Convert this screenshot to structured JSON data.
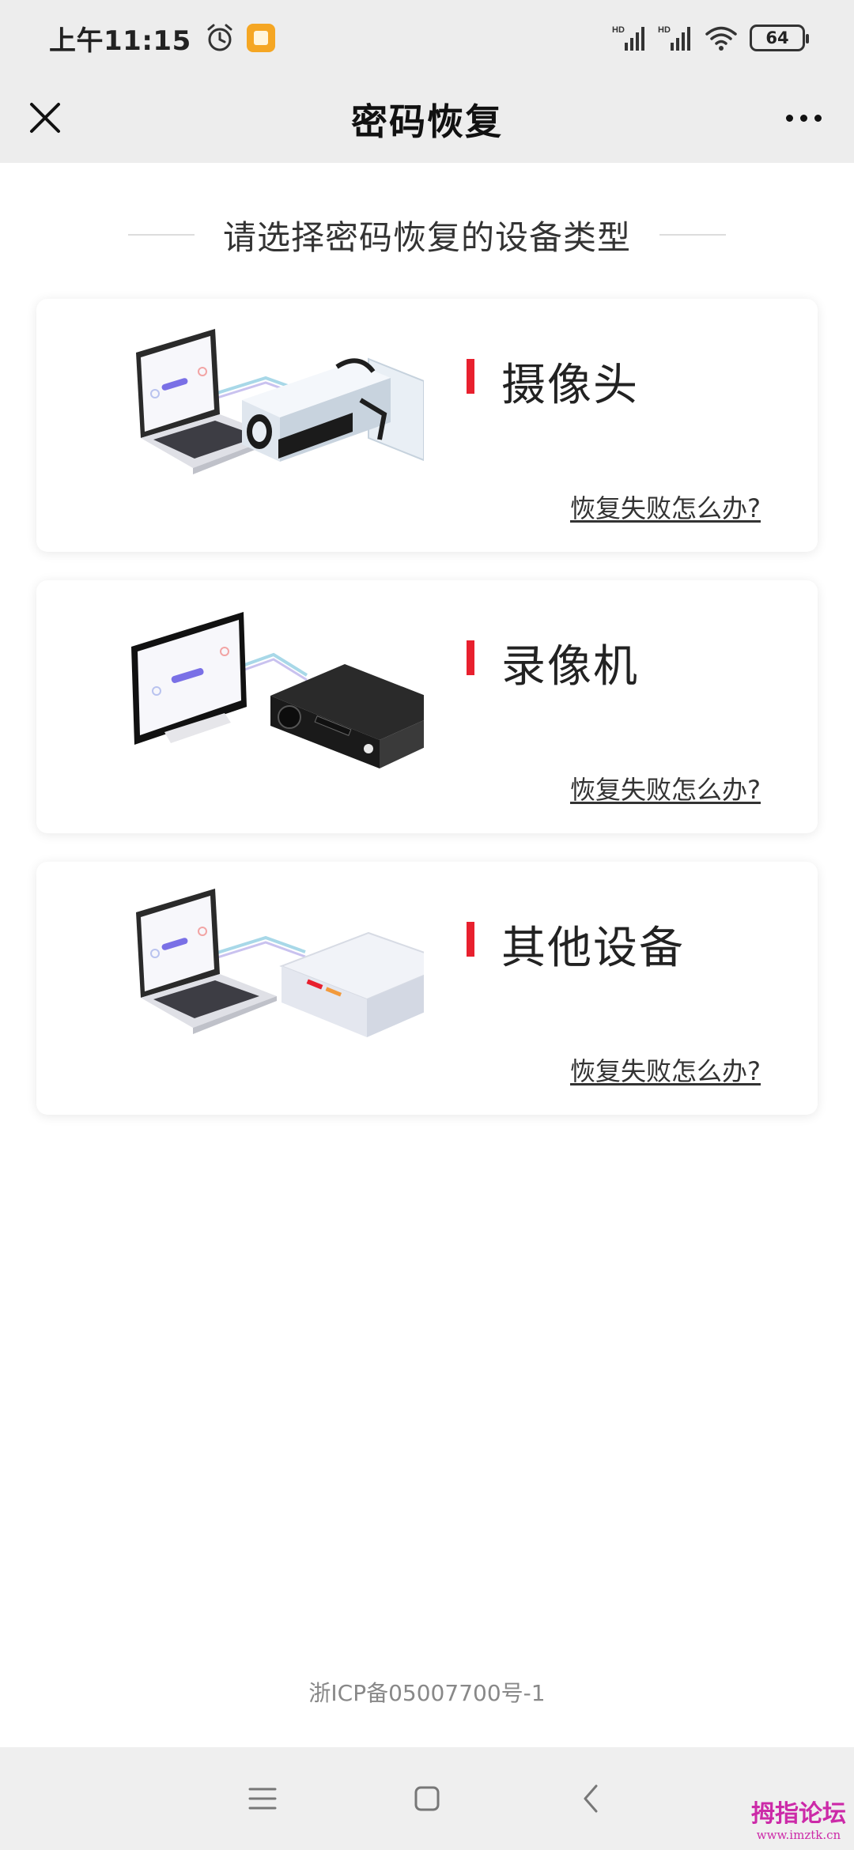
{
  "status_bar": {
    "time": "上午11:15",
    "network_1": "HD",
    "network_2": "HD",
    "battery": "64"
  },
  "title_bar": {
    "title": "密码恢复"
  },
  "section": {
    "heading": "请选择密码恢复的设备类型"
  },
  "devices": [
    {
      "name": "摄像头",
      "help_link": "恢复失败怎么办?"
    },
    {
      "name": "录像机",
      "help_link": "恢复失败怎么办?"
    },
    {
      "name": "其他设备",
      "help_link": "恢复失败怎么办?"
    }
  ],
  "footer": {
    "icp": "浙ICP备05007700号-1"
  },
  "watermark": {
    "main": "拇指论坛",
    "sub": "www.imztk.cn"
  },
  "colors": {
    "accent": "#e8202e",
    "header_bg": "#ededed",
    "nav_bg": "#efefef",
    "watermark": "#cc2aa8"
  },
  "icons": {
    "close": "close-icon",
    "more": "more-icon",
    "alarm": "alarm-icon",
    "menu": "menu-icon",
    "home": "home-icon",
    "back": "back-icon"
  }
}
